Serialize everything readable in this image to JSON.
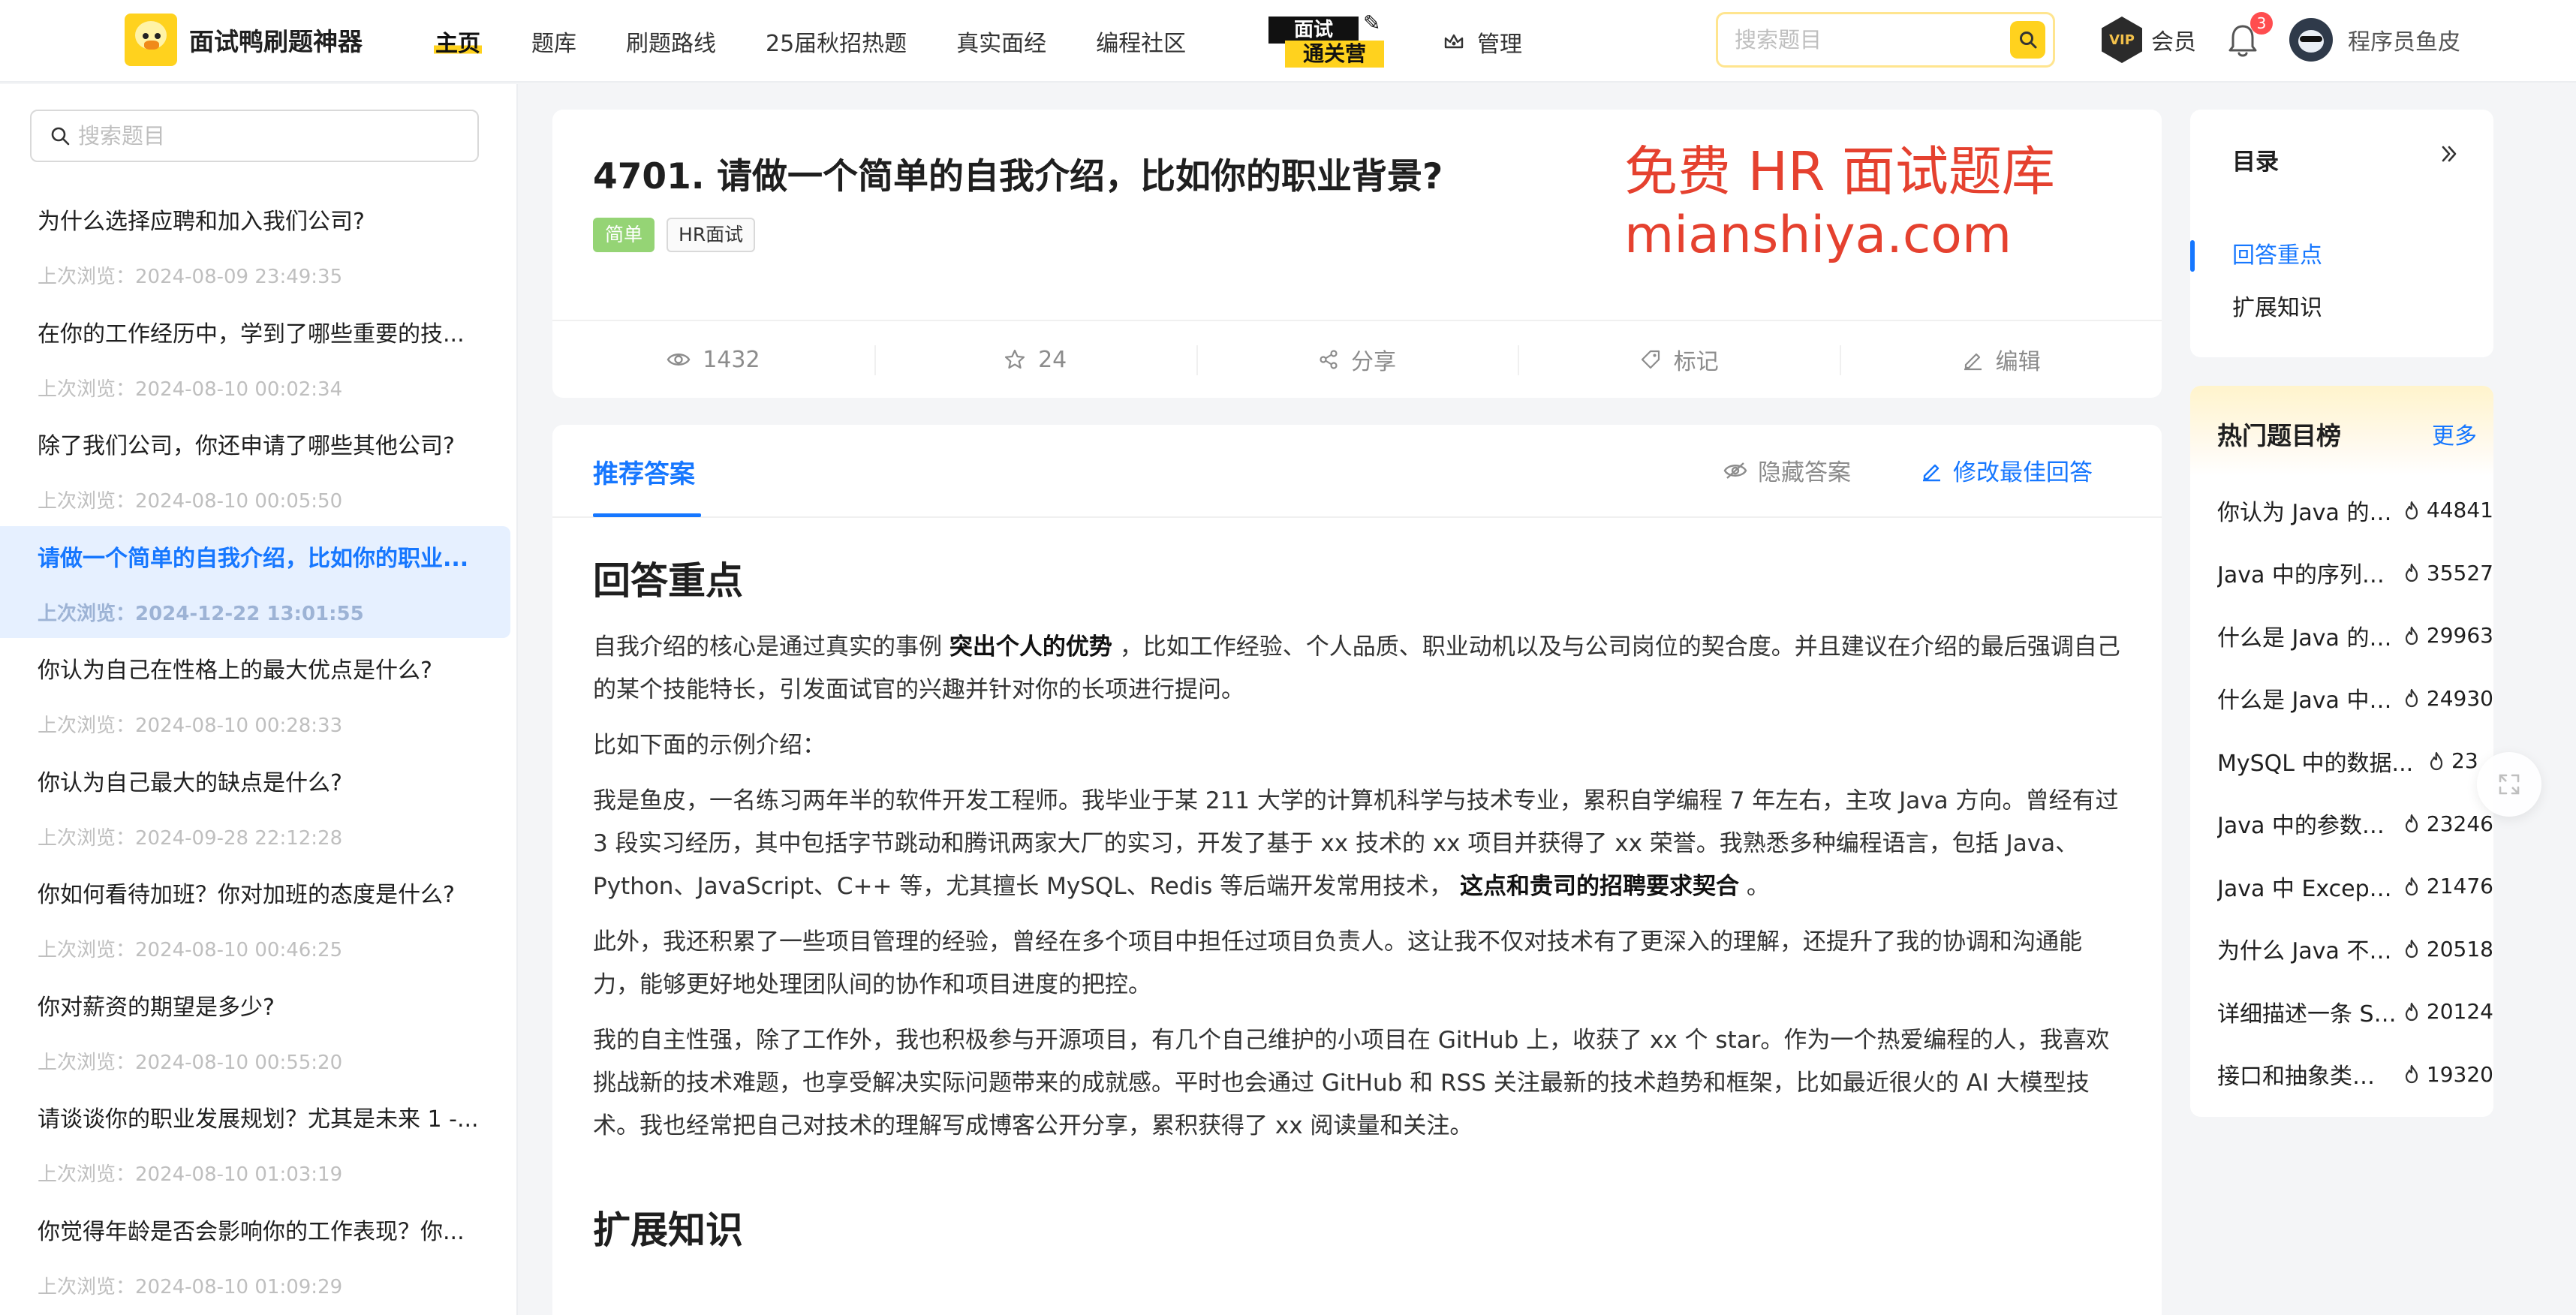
{
  "header": {
    "brand": "面试鸭刷题神器",
    "nav": [
      "主页",
      "题库",
      "刷题路线",
      "25届秋招热题",
      "真实面经",
      "编程社区"
    ],
    "camp_top": "面试",
    "camp_bottom": "通关营",
    "admin_label": "管理",
    "search_placeholder": "搜索题目",
    "vip_badge": "VIP",
    "vip_label": "会员",
    "notification_count": "3",
    "user_name": "程序员鱼皮"
  },
  "sidebar": {
    "search_placeholder": "搜索题目",
    "items": [
      {
        "q": "为什么选择应聘和加入我们公司?",
        "t": "上次浏览：2024-08-09 23:49:35"
      },
      {
        "q": "在你的工作经历中，学到了哪些重要的技...",
        "t": "上次浏览：2024-08-10 00:02:34"
      },
      {
        "q": "除了我们公司，你还申请了哪些其他公司?",
        "t": "上次浏览：2024-08-10 00:05:50"
      },
      {
        "q": "请做一个简单的自我介绍，比如你的职业...",
        "t": "上次浏览：2024-12-22 13:01:55"
      },
      {
        "q": "你认为自己在性格上的最大优点是什么?",
        "t": "上次浏览：2024-08-10 00:28:33"
      },
      {
        "q": "你认为自己最大的缺点是什么?",
        "t": "上次浏览：2024-09-28 22:12:28"
      },
      {
        "q": "你如何看待加班？你对加班的态度是什么?",
        "t": "上次浏览：2024-08-10 00:46:25"
      },
      {
        "q": "你对薪资的期望是多少?",
        "t": "上次浏览：2024-08-10 00:55:20"
      },
      {
        "q": "请谈谈你的职业发展规划？尤其是未来 1 -...",
        "t": "上次浏览：2024-08-10 01:03:19"
      },
      {
        "q": "你觉得年龄是否会影响你的工作表现？你...",
        "t": "上次浏览：2024-08-10 01:09:29"
      }
    ]
  },
  "question": {
    "title": "4701. 请做一个简单的自我介绍，比如你的职业背景?",
    "difficulty": "简单",
    "category_tag": "HR面试",
    "promo_line1": "免费 HR 面试题库",
    "promo_line2": "mianshiya.com",
    "stats": {
      "views": "1432",
      "stars": "24",
      "share": "分享",
      "mark": "标记",
      "edit": "编辑"
    }
  },
  "answer": {
    "tab_label": "推荐答案",
    "hide_label": "隐藏答案",
    "edit_label": "修改最佳回答",
    "h_key": "回答重点",
    "p1_a": "自我介绍的核心是通过真实的事例",
    "p1_b": "突出个人的优势",
    "p1_c": "，比如工作经验、个人品质、职业动机以及与公司岗位的契合度。并且建议在介绍的最后强调自己的某个技能特长，引发面试官的兴趣并针对你的长项进行提问。",
    "p2": "比如下面的示例介绍：",
    "p3_a": "我是鱼皮，一名练习两年半的软件开发工程师。我毕业于某 211 大学的计算机科学与技术专业，累积自学编程 7 年左右，主攻 Java 方向。曾经有过 3 段实习经历，其中包括字节跳动和腾讯两家大厂的实习，开发了基于 xx 技术的 xx 项目并获得了 xx 荣誉。我熟悉多种编程语言，包括 Java、Python、JavaScript、C++ 等，尤其擅长 MySQL、Redis 等后端开发常用技术，",
    "p3_b": "这点和贵司的招聘要求契合",
    "p3_c": "。",
    "p4": "此外，我还积累了一些项目管理的经验，曾经在多个项目中担任过项目负责人。这让我不仅对技术有了更深入的理解，还提升了我的协调和沟通能力，能够更好地处理团队间的协作和项目进度的把控。",
    "p5": "我的自主性强，除了工作外，我也积极参与开源项目，有几个自己维护的小项目在 GitHub 上，收获了 xx 个 star。作为一个热爱编程的人，我喜欢挑战新的技术难题，也享受解决实际问题带来的成就感。平时也会通过 GitHub 和 RSS 关注最新的技术趋势和框架，比如最近很火的 AI 大模型技术。我也经常把自己对技术的理解写成博客公开分享，累积获得了 xx 阅读量和关注。",
    "h_ext": "扩展知识"
  },
  "toc": {
    "title": "目录",
    "items": [
      "回答重点",
      "扩展知识"
    ]
  },
  "hot": {
    "title": "热门题目榜",
    "more": "更多",
    "items": [
      {
        "q": "你认为 Java 的优...",
        "n": "44841"
      },
      {
        "q": "Java 中的序列化...",
        "n": "35527"
      },
      {
        "q": "什么是 Java 的多...",
        "n": "29963"
      },
      {
        "q": "什么是 Java 中的...",
        "n": "24930"
      },
      {
        "q": "MySQL 中的数据...",
        "n": "23"
      },
      {
        "q": "Java 中的参数传...",
        "n": "23246"
      },
      {
        "q": "Java 中 Exception...",
        "n": "21476"
      },
      {
        "q": "为什么 Java 不支...",
        "n": "20518"
      },
      {
        "q": "详细描述一条 SQL...",
        "n": "20124"
      },
      {
        "q": "接口和抽象类有什...",
        "n": "19320"
      }
    ]
  },
  "colors": {
    "brand": "#ffd21e",
    "link": "#1677ff",
    "promo": "#e5412f",
    "easy": "#95d475"
  }
}
